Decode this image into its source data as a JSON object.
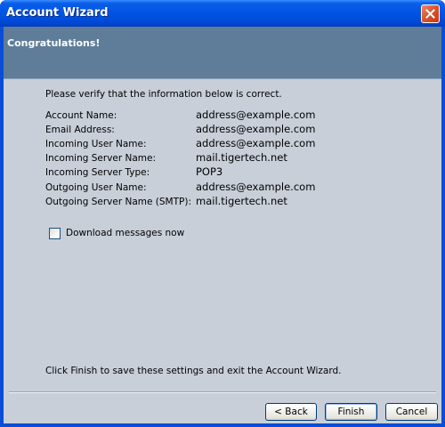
{
  "window": {
    "title": "Account Wizard",
    "close_icon": "close-icon"
  },
  "banner": {
    "title": "Congratulations!"
  },
  "main": {
    "intro": "Please verify that the information below is correct.",
    "rows": [
      {
        "label": "Account Name:",
        "value": "address@example.com"
      },
      {
        "label": "Email Address:",
        "value": "address@example.com"
      },
      {
        "label": "Incoming User Name:",
        "value": "address@example.com"
      },
      {
        "label": "Incoming Server Name:",
        "value": "mail.tigertech.net"
      },
      {
        "label": "Incoming Server Type:",
        "value": "POP3"
      },
      {
        "label": "Outgoing User Name:",
        "value": "address@example.com"
      },
      {
        "label": "Outgoing Server Name (SMTP):",
        "value": "mail.tigertech.net"
      }
    ],
    "download_checkbox": {
      "label": "Download messages now",
      "checked": false
    },
    "footer": "Click Finish to save these settings and exit the Account Wizard."
  },
  "buttons": {
    "back": "< Back",
    "finish": "Finish",
    "cancel": "Cancel"
  },
  "colors": {
    "titlebar": "#0054e3",
    "banner": "#5f7d99",
    "client": "#c9cfd9"
  }
}
